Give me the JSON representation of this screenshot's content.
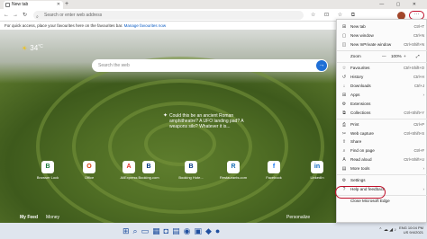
{
  "tab": {
    "title": "New tab",
    "close": "✕",
    "new": "+"
  },
  "window": {
    "controls": "— ▢ ✕"
  },
  "address": {
    "placeholder": "Search or enter web address"
  },
  "toolbar": {
    "more": "···",
    "icons": "☆ ⊡ ☆ ⧉"
  },
  "favbar": {
    "text": "For quick access, place your favourites here on the favourites bar.",
    "link": "Manage favourites now"
  },
  "weather": {
    "temp": "34",
    "unit": "°C"
  },
  "search": {
    "placeholder": "Search the web"
  },
  "fact": {
    "text": "Could this be an ancient Roman amphitheatre? A UFO landing pad? A weapons silo? Whatever it is..."
  },
  "tiles": [
    {
      "label": "Browser Lock",
      "glyph": "B",
      "color": "#1c7a3c"
    },
    {
      "label": "Office",
      "glyph": "O",
      "color": "#d83b01"
    },
    {
      "label": "AliExpress",
      "glyph": "A",
      "color": "#e43225"
    },
    {
      "label": "Booking.com",
      "glyph": "B",
      "color": "#003580"
    },
    {
      "label": "Booking Hote...",
      "glyph": "B",
      "color": "#003580"
    },
    {
      "label": "Restaurants.com",
      "glyph": "R",
      "color": "#1a6fb5"
    },
    {
      "label": "Facebook",
      "glyph": "f",
      "color": "#1877f2"
    },
    {
      "label": "LinkedIn",
      "glyph": "in",
      "color": "#0a66c2"
    }
  ],
  "bottom": {
    "myfeed": "My Feed",
    "money": "Money",
    "personalize": "Personalize"
  },
  "tray": {
    "lang": "ENG",
    "region": "US",
    "time": "10:04 PM",
    "date": "9/4/2021"
  },
  "menu": {
    "items": [
      {
        "label": "New tab",
        "shortcut": "Ctrl+T",
        "icon": "⊞"
      },
      {
        "label": "New window",
        "shortcut": "Ctrl+N",
        "icon": "▢"
      },
      {
        "label": "New InPrivate window",
        "shortcut": "Ctrl+Shift+N",
        "icon": "◫"
      },
      {
        "label": "Favourites",
        "shortcut": "Ctrl+Shift+O",
        "icon": "☆"
      },
      {
        "label": "Collections",
        "shortcut": "Ctrl+Shift+Y",
        "icon": "⧉"
      },
      {
        "label": "History",
        "shortcut": "Ctrl+H",
        "icon": "↺"
      },
      {
        "label": "Downloads",
        "shortcut": "Ctrl+J",
        "icon": "↓"
      },
      {
        "label": "Apps",
        "shortcut": "",
        "icon": "⊞",
        "arrow": "›"
      },
      {
        "label": "Extensions",
        "shortcut": "",
        "icon": "⚙"
      },
      {
        "label": "Collections",
        "shortcut": "Ctrl+Shift+Y",
        "icon": "⧉"
      },
      {
        "label": "Print",
        "shortcut": "Ctrl+P",
        "icon": "⎙"
      },
      {
        "label": "Web capture",
        "shortcut": "Ctrl+Shift+S",
        "icon": "✂"
      },
      {
        "label": "Share",
        "shortcut": "",
        "icon": "⇪"
      },
      {
        "label": "Find on page",
        "shortcut": "Ctrl+F",
        "icon": "⌕"
      },
      {
        "label": "Read aloud",
        "shortcut": "Ctrl+Shift+U",
        "icon": "A"
      },
      {
        "label": "More tools",
        "shortcut": "",
        "icon": "▤",
        "arrow": "›"
      },
      {
        "label": "Settings",
        "shortcut": "",
        "icon": "⚙"
      },
      {
        "label": "Help and feedback",
        "shortcut": "",
        "icon": "?",
        "arrow": "›"
      },
      {
        "label": "Close Microsoft Edge",
        "shortcut": "",
        "icon": ""
      }
    ],
    "zoom": {
      "label": "Zoom",
      "minus": "—",
      "value": "100%",
      "plus": "+",
      "fullscreen": "⤢"
    }
  }
}
